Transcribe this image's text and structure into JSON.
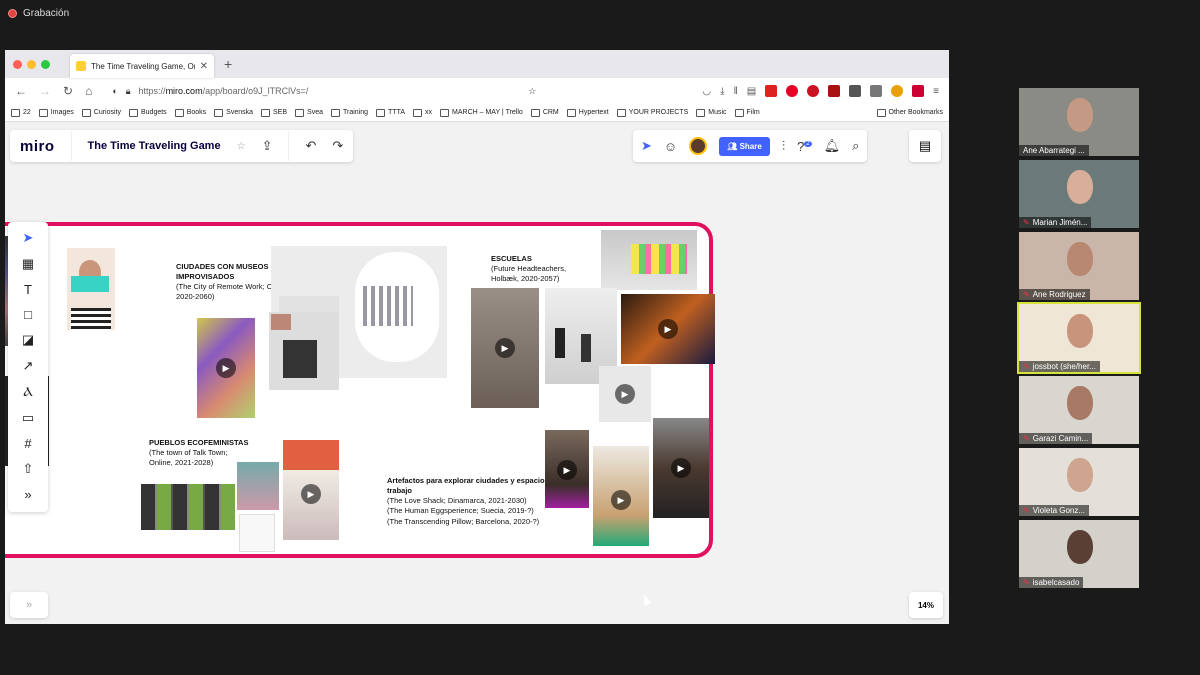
{
  "recording": {
    "label": "Grabación"
  },
  "browser": {
    "tab_title": "The Time Traveling Game, Onli",
    "url_prefix": "https://",
    "url_host": "miro.com",
    "url_path": "/app/board/o9J_lTRClVs=/",
    "bookmarks": [
      "22",
      "Images",
      "Curiosity",
      "Budgets",
      "Books",
      "Svenska",
      "SEB",
      "Svea",
      "Training",
      "TTTA",
      "xx",
      "MARCH – MAY | Trello",
      "CRM",
      "Hypertext",
      "YOUR PROJECTS",
      "Music",
      "Film",
      "Other Bookmarks"
    ]
  },
  "miro": {
    "logo": "miro",
    "board_title": "The Time Traveling Game",
    "share_label": "Share",
    "zoom": "14%",
    "notification_badge": "2"
  },
  "board": {
    "ciudades": {
      "title": "CIUDADES CON MUSEOS PARTICIPATIVOS E IMPROVISADOS",
      "lines": [
        "(The City of Remote Work; Online,",
        "2020-2060)"
      ]
    },
    "escuelas": {
      "title": "ESCUELAS",
      "lines": [
        "(Future Headteachers,",
        "Holbæk, 2020-2057)"
      ]
    },
    "pueblos": {
      "title": "PUEBLOS ECOFEMINISTAS",
      "lines": [
        "(The town of Talk Town;",
        "Online, 2021-2028)"
      ]
    },
    "artefactos": {
      "title": "Artefactos para explorar ciudades y espacios de trabajo",
      "lines": [
        "(The Love Shack; Dinamarca, 2021-2030)",
        "(The Human Eggsperience; Suecia, 2019-?)",
        "(The Transcending Pillow; Barcelona, 2020-?)"
      ]
    }
  },
  "participants": [
    {
      "name": "Ane Abarrategi ...",
      "muted": false
    },
    {
      "name": "Marian Jimén...",
      "muted": true
    },
    {
      "name": "Ane Rodriguez",
      "muted": true
    },
    {
      "name": "jossbot (she/her...",
      "muted": true
    },
    {
      "name": "Garazi Camin...",
      "muted": true
    },
    {
      "name": "Violeta Gonz...",
      "muted": true
    },
    {
      "name": "isabelcasado",
      "muted": true
    }
  ]
}
